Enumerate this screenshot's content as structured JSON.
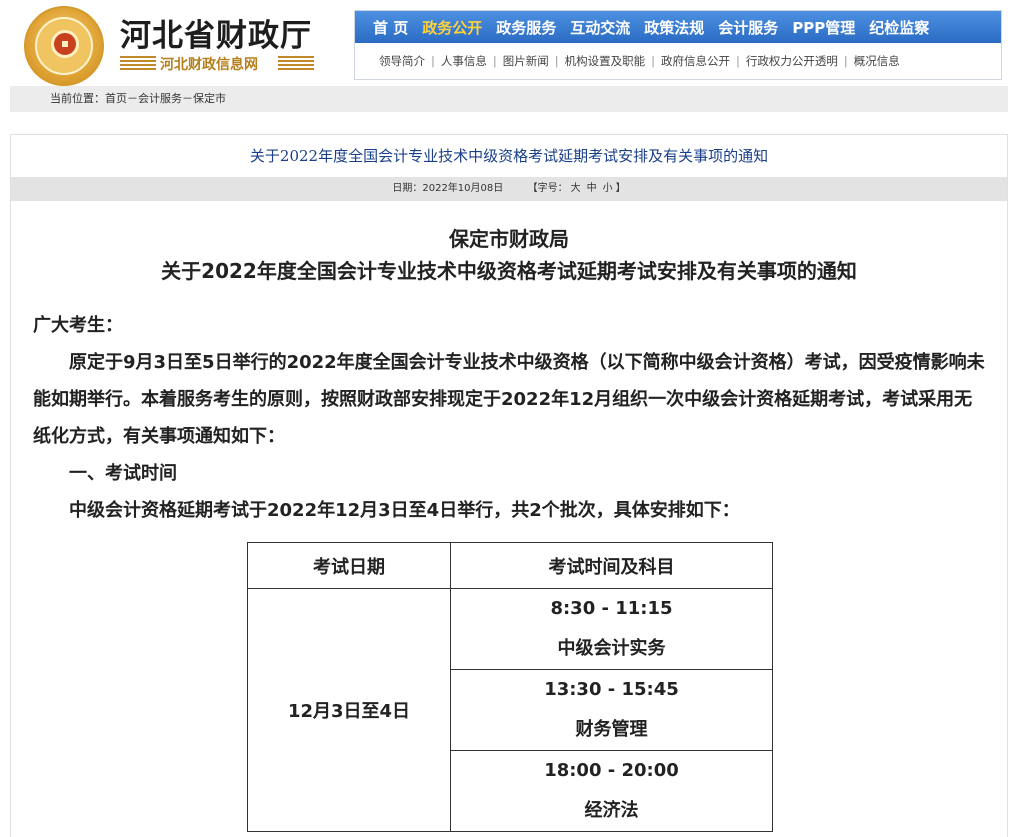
{
  "header": {
    "site_title": "河北省财政厅",
    "site_subtitle": "河北财政信息网",
    "nav": [
      "首 页",
      "政务公开",
      "政务服务",
      "互动交流",
      "政策法规",
      "会计服务",
      "PPP管理",
      "纪检监察"
    ],
    "nav_active_index": 1,
    "subnav": [
      "领导简介",
      "人事信息",
      "图片新闻",
      "机构设置及职能",
      "政府信息公开",
      "行政权力公开透明",
      "概况信息"
    ]
  },
  "breadcrumb": "当前位置：首页－会计服务－保定市",
  "article": {
    "title": "关于2022年度全国会计专业技术中级资格考试延期考试安排及有关事项的通知",
    "date_label": "日期：",
    "date": "2022年10月08日",
    "font_size_label": "【字号：",
    "font_sizes": [
      "大",
      "中",
      "小"
    ],
    "font_size_close": "】",
    "doc_org": "保定市财政局",
    "doc_title": "关于2022年度全国会计专业技术中级资格考试延期考试安排及有关事项的通知",
    "greeting": "广大考生：",
    "para1": "原定于9月3日至5日举行的2022年度全国会计专业技术中级资格（以下简称中级会计资格）考试，因受疫情影响未能如期举行。本着服务考生的原则，按照财政部安排现定于2022年12月组织一次中级会计资格延期考试，考试采用无纸化方式，有关事项通知如下：",
    "section1": "一、考试时间",
    "para2": "中级会计资格延期考试于2022年12月3日至4日举行，共2个批次，具体安排如下：",
    "table": {
      "headers": [
        "考试日期",
        "考试时间及科目"
      ],
      "date": "12月3日至4日",
      "slots": [
        {
          "time": "8:30 - 11:15",
          "subject": "中级会计实务"
        },
        {
          "time": "13:30 - 15:45",
          "subject": "财务管理"
        },
        {
          "time": "18:00 - 20:00",
          "subject": "经济法"
        }
      ]
    }
  },
  "colors": {
    "nav_bg": "#2a6cc4",
    "nav_active": "#ffd23a",
    "title_blue": "#1a3f8a",
    "logo_gold": "#b67f1c"
  }
}
